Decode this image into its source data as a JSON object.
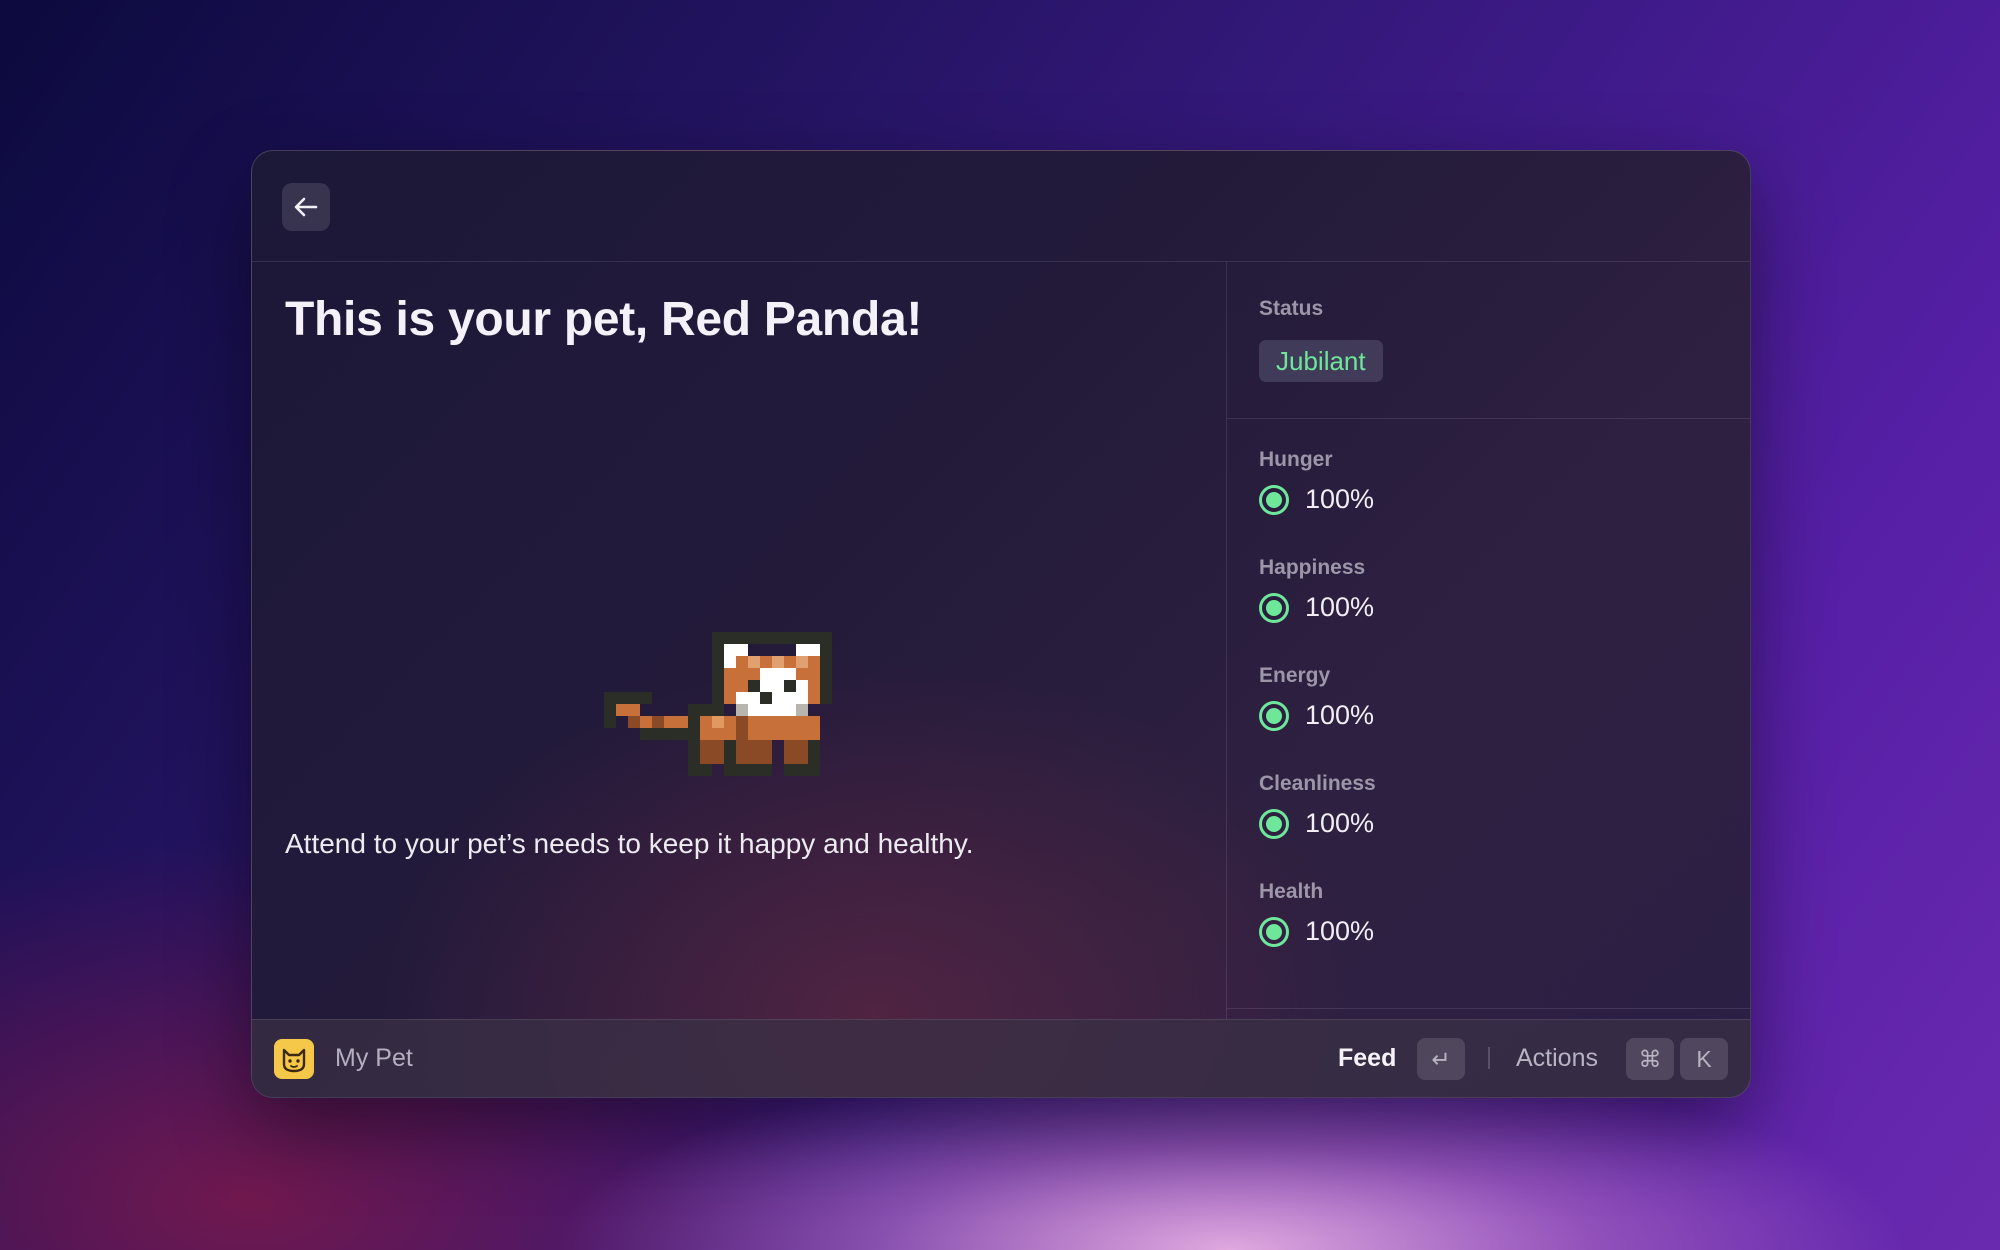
{
  "header": {
    "back_icon": "arrow-left-icon"
  },
  "main": {
    "title": "This is your pet, Red Panda!",
    "description": "Attend to your pet’s needs to keep it happy and healthy.",
    "pet_image": "red-panda-pixel-sprite"
  },
  "sidebar": {
    "status_label": "Status",
    "status_value": "Jubilant",
    "status_color": "#6EE79A",
    "stats": [
      {
        "label": "Hunger",
        "value": "100%"
      },
      {
        "label": "Happiness",
        "value": "100%"
      },
      {
        "label": "Energy",
        "value": "100%"
      },
      {
        "label": "Cleanliness",
        "value": "100%"
      },
      {
        "label": "Health",
        "value": "100%"
      }
    ]
  },
  "footer": {
    "app_icon": "cat-icon",
    "app_name": "My Pet",
    "primary_action": "Feed",
    "primary_key": "↵",
    "actions_label": "Actions",
    "actions_keys": [
      "⌘",
      "K"
    ]
  }
}
